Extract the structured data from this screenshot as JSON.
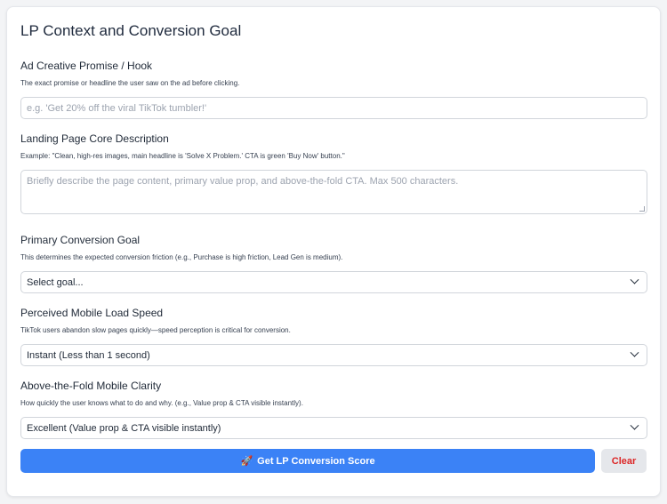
{
  "page": {
    "title": "LP Context and Conversion Goal"
  },
  "fields": {
    "ad_hook": {
      "label": "Ad Creative Promise / Hook",
      "help": "The exact promise or headline the user saw on the ad before clicking.",
      "placeholder": "e.g. 'Get 20% off the viral TikTok tumbler!'"
    },
    "lp_description": {
      "label": "Landing Page Core Description",
      "help": "Example: \"Clean, high-res images, main headline is 'Solve X Problem.' CTA is green 'Buy Now' button.\"",
      "placeholder": "Briefly describe the page content, primary value prop, and above-the-fold CTA. Max 500 characters."
    },
    "conversion_goal": {
      "label": "Primary Conversion Goal",
      "help": "This determines the expected conversion friction (e.g., Purchase is high friction, Lead Gen is medium).",
      "value": "Select goal..."
    },
    "load_speed": {
      "label": "Perceived Mobile Load Speed",
      "help": "TikTok users abandon slow pages quickly—speed perception is critical for conversion.",
      "value": "Instant (Less than 1 second)"
    },
    "clarity": {
      "label": "Above-the-Fold Mobile Clarity",
      "help": "How quickly the user knows what to do and why. (e.g., Value prop & CTA visible instantly).",
      "value": "Excellent (Value prop & CTA visible instantly)"
    }
  },
  "actions": {
    "primary_label": "Get LP Conversion Score",
    "primary_icon": "rocket-icon",
    "clear_label": "Clear"
  },
  "colors": {
    "primary": "#3b82f6",
    "clear_text": "#dc2626",
    "clear_bg": "#e5e7eb"
  }
}
